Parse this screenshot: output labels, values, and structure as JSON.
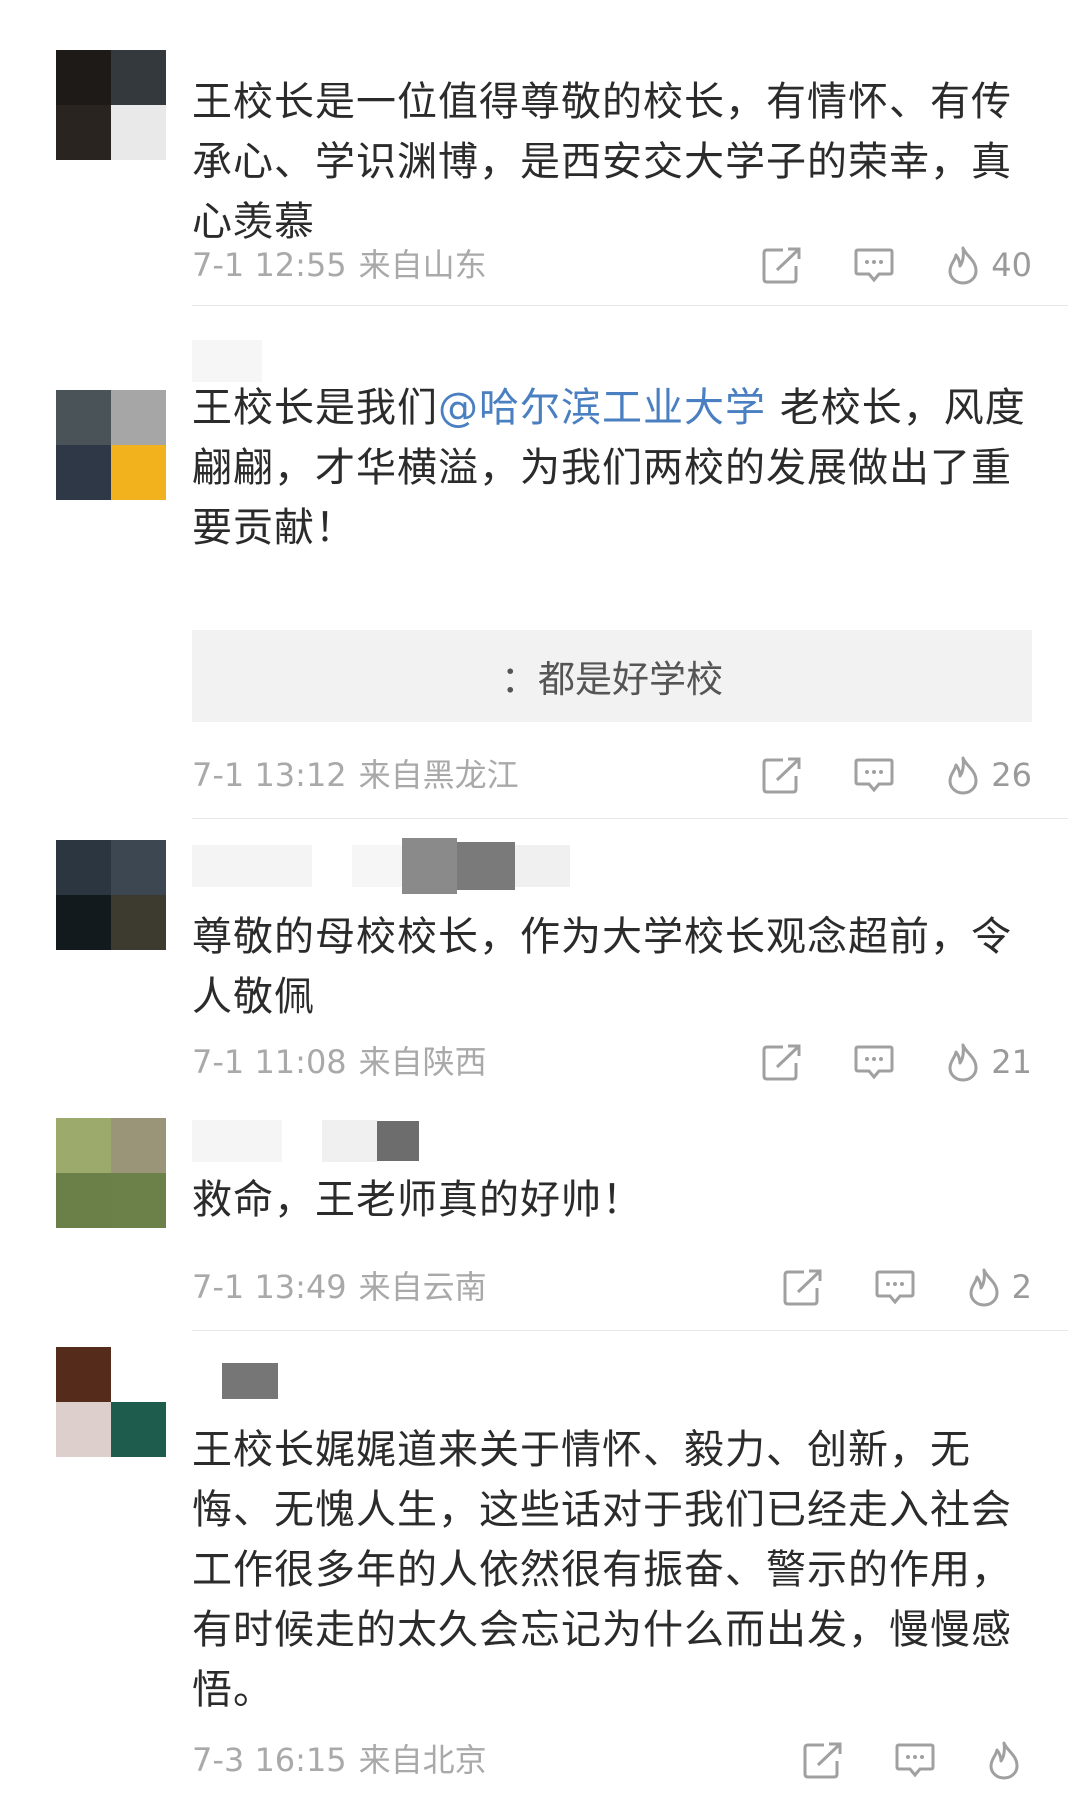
{
  "comments": [
    {
      "text": "王校长是一位值得尊敬的校长，有情怀、有传承心、学识渊博，是西安交大学子的荣幸，真心羡慕",
      "date": "7-1 12:55",
      "location": "来自山东",
      "likes": "40"
    },
    {
      "text_before": "王校长是我们",
      "mention": "@哈尔滨工业大学",
      "text_after": " 老校长，风度翩翩，才华横溢，为我们两校的发展做出了重要贡献！",
      "reply": "：都是好学校",
      "date": "7-1 13:12",
      "location": "来自黑龙江",
      "likes": "26"
    },
    {
      "text": "尊敬的母校校长，作为大学校长观念超前，令人敬佩",
      "date": "7-1 11:08",
      "location": "来自陕西",
      "likes": "21"
    },
    {
      "text": "救命，王老师真的好帅！",
      "date": "7-1 13:49",
      "location": "来自云南",
      "likes": "2"
    },
    {
      "text": "王校长娓娓道来关于情怀、毅力、创新，无悔、无愧人生，这些话对于我们已经走入社会工作很多年的人依然很有振奋、警示的作用，有时候走的太久会忘记为什么而出发，慢慢感悟。",
      "date": "7-3 16:15",
      "location": "来自北京",
      "likes": ""
    }
  ],
  "icons": {
    "share": "share-icon",
    "comment": "comment-icon",
    "like": "flame-like-icon"
  },
  "colors": {
    "text": "#2b2b2b",
    "meta": "#a9a9a9",
    "mention": "#4a7fc1",
    "reply_bg": "#f2f2f2"
  }
}
